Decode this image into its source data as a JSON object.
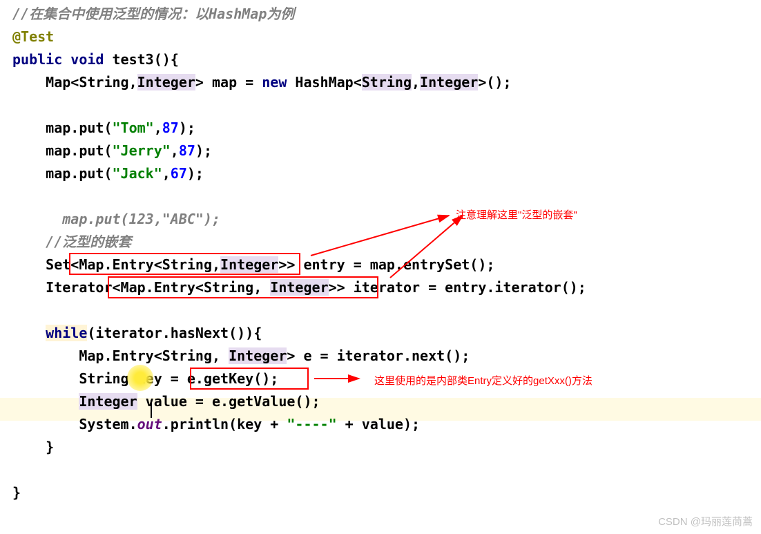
{
  "code": {
    "comment1": "//在集合中使用泛型的情况：以HashMap为例",
    "annotation": "@Test",
    "kw_public": "public",
    "kw_void": "void",
    "method_name": "test3",
    "map_decl_1": "Map<String,",
    "integer": "Integer",
    "map_decl_2": "> map = ",
    "kw_new": "new",
    "hashmap_1": " HashMap<",
    "string_type": "String",
    "comma": ",",
    "hashmap_2": ">();",
    "put1_a": "map.put(",
    "put1_str": "\"Tom\"",
    "put1_num": "87",
    "put2_str": "\"Jerry\"",
    "put2_num": "87",
    "put3_str": "\"Jack\"",
    "put3_num": "67",
    "put4_num": "123",
    "put4_str": "\"ABC\"",
    "comment2": "//泛型的嵌套",
    "set_line": "Set<Map.Entry<String,Integer>> entry = map.entrySet();",
    "iter_line": "Iterator<Map.Entry<String, Integer>> iterator = entry.iterator();",
    "kw_while": "while",
    "while_cond": "(iterator.hasNext()){",
    "entry_line_1": "Map.Entry<String, ",
    "entry_line_2": "> e = iterator.next();",
    "string_key": "String key = e.getKey();",
    "integer_val": " value = e.getValue();",
    "sysout_1": "System.",
    "sysout_out": "out",
    "sysout_2": ".println(key + ",
    "dash_str": "\"----\"",
    "sysout_3": " + value);"
  },
  "annotations": {
    "note1": "注意理解这里\"泛型的嵌套\"",
    "note2": "这里使用的是内部类Entry定义好的getXxx()方法"
  },
  "watermark": "CSDN @玛丽莲茼蒿"
}
